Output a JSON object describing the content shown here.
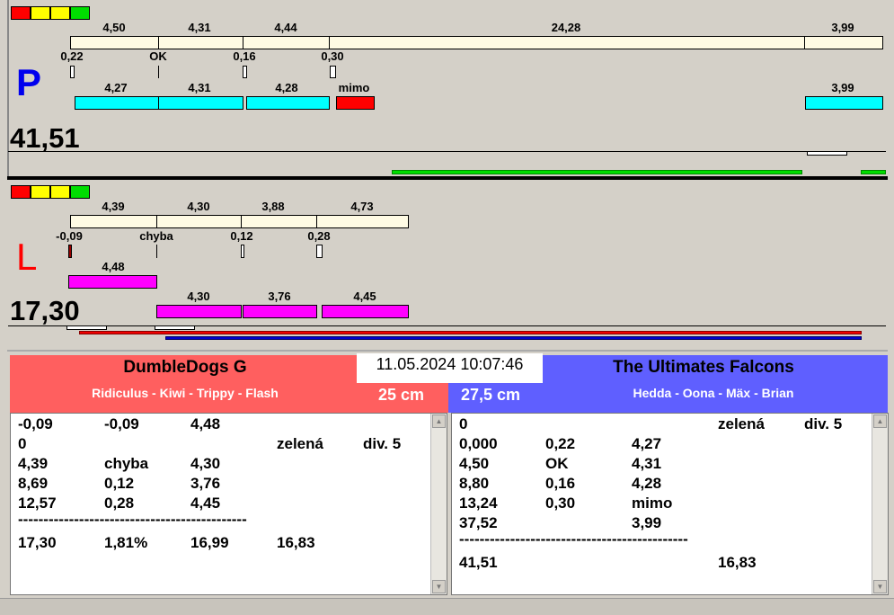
{
  "colors": {
    "red": "#ff0000",
    "yellow": "#ffff00",
    "green": "#00dd00",
    "cyan": "#00ffff",
    "magenta": "#ff00ff",
    "team_left": "#ff5f5f",
    "team_right": "#5f5fff"
  },
  "p": {
    "letter": "P",
    "total": "41,51",
    "top_labels": [
      "4,50",
      "4,31",
      "4,44",
      "24,28",
      "3,99"
    ],
    "mid_labels": [
      "0,22",
      "OK",
      "0,16",
      "0,30"
    ],
    "bottom_labels": [
      "4,27",
      "4,31",
      "4,28",
      "mimo",
      "3,99"
    ]
  },
  "l": {
    "letter": "L",
    "total": "17,30",
    "top_labels": [
      "4,39",
      "4,30",
      "3,88",
      "4,73"
    ],
    "mid_labels": [
      "-0,09",
      "chyba",
      "0,12",
      "0,28"
    ],
    "first_label": "4,48",
    "bottom_labels": [
      "4,30",
      "3,76",
      "4,45"
    ]
  },
  "datetime": "11.05.2024 10:07:46",
  "left_team": {
    "name": "DumbleDogs G",
    "players": "Ridiculus - Kiwi - Trippy - Flash",
    "distance": "25 cm",
    "rows": [
      [
        "-0,09",
        "-0,09",
        "4,48",
        "",
        ""
      ],
      [
        "0",
        "",
        "",
        "zelená",
        "div. 5"
      ],
      [
        "4,39",
        "chyba",
        "4,30",
        "",
        ""
      ],
      [
        "8,69",
        "0,12",
        "3,76",
        "",
        ""
      ],
      [
        "12,57",
        "0,28",
        "4,45",
        "",
        ""
      ]
    ],
    "separator": "---------------------------------------------",
    "summary": [
      "17,30",
      "1,81%",
      "16,99",
      "16,83"
    ]
  },
  "right_team": {
    "name": "The Ultimates Falcons",
    "players": "Hedda - Oona - Mäx - Brian",
    "distance": "27,5 cm",
    "rows": [
      [
        "0",
        "",
        "",
        "zelená",
        "div. 5"
      ],
      [
        "0,000",
        "0,22",
        "4,27",
        "",
        ""
      ],
      [
        "4,50",
        "OK",
        "4,31",
        "",
        ""
      ],
      [
        "8,80",
        "0,16",
        "4,28",
        "",
        ""
      ],
      [
        "13,24",
        "0,30",
        "mimo",
        "",
        ""
      ],
      [
        "37,52",
        "",
        "3,99",
        "",
        ""
      ]
    ],
    "separator": "---------------------------------------------",
    "summary": [
      "41,51",
      "",
      "",
      "16,83"
    ]
  }
}
